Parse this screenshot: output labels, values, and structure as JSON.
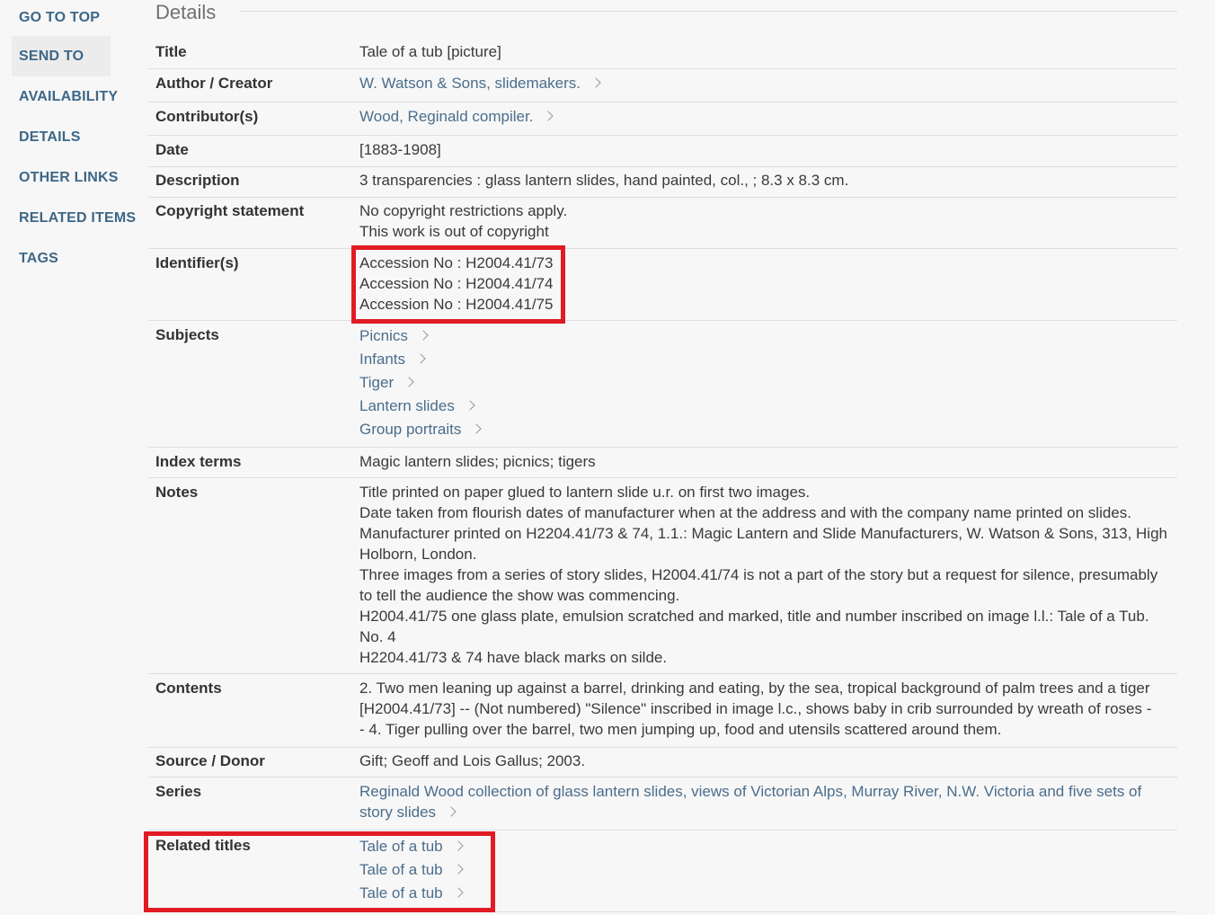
{
  "nav": {
    "go_to_top": "GO TO TOP",
    "send_to": "SEND TO",
    "availability": "AVAILABILITY",
    "details": "DETAILS",
    "other_links": "OTHER LINKS",
    "related_items": "RELATED ITEMS",
    "tags": "TAGS"
  },
  "details": {
    "heading": "Details",
    "title": {
      "label": "Title",
      "value": "Tale of a tub [picture]"
    },
    "author": {
      "label": "Author / Creator",
      "value": "W. Watson & Sons, slidemakers."
    },
    "contributor": {
      "label": "Contributor(s)",
      "value": "Wood, Reginald compiler."
    },
    "date": {
      "label": "Date",
      "value": "[1883-1908]"
    },
    "description": {
      "label": "Description",
      "value": "3 transparencies : glass lantern slides, hand painted, col., ; 8.3 x 8.3 cm."
    },
    "copyright": {
      "label": "Copyright statement",
      "lines": [
        "No copyright restrictions apply.",
        "This work is out of copyright"
      ]
    },
    "identifiers": {
      "label": "Identifier(s)",
      "lines": [
        "Accession No : H2004.41/73",
        "Accession No : H2004.41/74",
        "Accession No : H2004.41/75"
      ]
    },
    "subjects": {
      "label": "Subjects",
      "items": [
        "Picnics",
        "Infants",
        "Tiger",
        "Lantern slides",
        "Group portraits"
      ]
    },
    "index_terms": {
      "label": "Index terms",
      "value": "Magic lantern slides; picnics; tigers"
    },
    "notes": {
      "label": "Notes",
      "lines": [
        "Title printed on paper glued to lantern slide u.r. on first two images.",
        "Date taken from flourish dates of manufacturer when at the address and with the company name printed on slides.",
        "Manufacturer printed on H2204.41/73 & 74, 1.1.: Magic Lantern and Slide Manufacturers, W. Watson & Sons, 313, High",
        "Holborn, London.",
        "Three images from a series of story slides, H2004.41/74 is not a part of the story but a request for silence, presumably",
        "to tell the audience the show was commencing.",
        "H2004.41/75 one glass plate, emulsion scratched and marked, title and number inscribed on image l.l.: Tale of a Tub.",
        "No. 4",
        "H2204.41/73 & 74 have black marks on silde."
      ]
    },
    "contents": {
      "label": "Contents",
      "lines": [
        "2. Two men leaning up against a barrel, drinking and eating, by the sea, tropical background of palm trees and a tiger",
        "[H2004.41/73] -- (Not numbered) \"Silence\" inscribed in image l.c., shows baby in crib surrounded by wreath of roses -",
        "- 4. Tiger pulling over the barrel, two men jumping up, food and utensils scattered around them."
      ]
    },
    "source": {
      "label": "Source / Donor",
      "value": "Gift; Geoff and Lois Gallus; 2003."
    },
    "series": {
      "label": "Series",
      "lines": [
        "Reginald Wood collection of glass lantern slides, views of Victorian Alps, Murray River, N.W. Victoria and five sets of",
        "story slides"
      ]
    },
    "related_titles": {
      "label": "Related titles",
      "items": [
        "Tale of a tub",
        "Tale of a tub",
        "Tale of a tub"
      ]
    }
  },
  "colors": {
    "nav_text": "#3d6787",
    "link": "#4b6d8c",
    "highlight_border": "#e01b24",
    "background": "#f7f7f7"
  },
  "icons": {
    "link_chevron": "chevron-right-icon"
  }
}
